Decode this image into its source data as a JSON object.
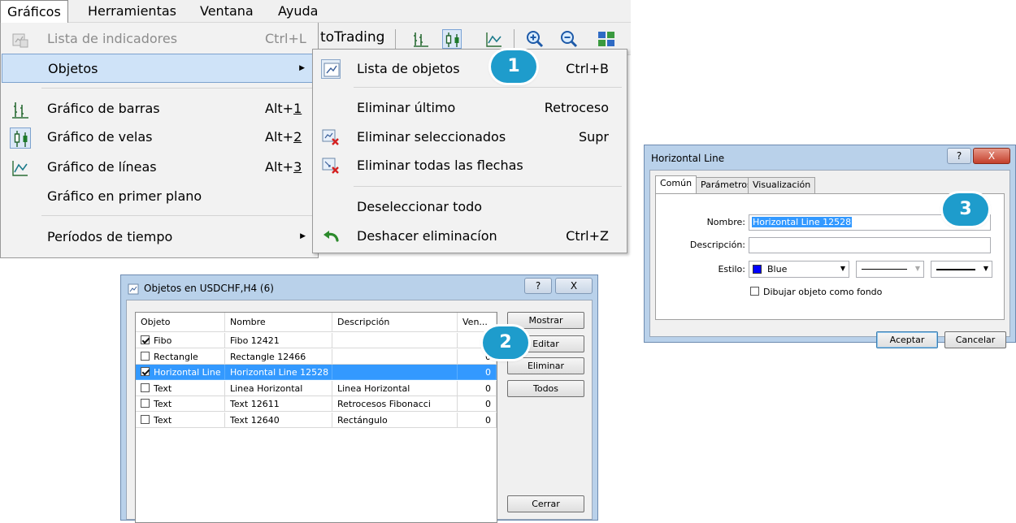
{
  "menubar": {
    "items": [
      "Gráficos",
      "Herramientas",
      "Ventana",
      "Ayuda"
    ]
  },
  "toolbar": {
    "autotrading_fragment": "toTrading"
  },
  "graficos_menu": {
    "items": [
      {
        "label": "Lista de indicadores",
        "shortcut": "Ctrl+L",
        "icon": "indicator-list-icon",
        "disabled": true
      },
      {
        "label": "Objetos",
        "shortcut": "",
        "icon": "",
        "submenu": true,
        "highlighted": true
      },
      {
        "label": "Gráfico de barras",
        "shortcut_prefix": "Alt+",
        "shortcut_key": "1",
        "icon": "bar-chart-icon"
      },
      {
        "label": "Gráfico de velas",
        "shortcut_prefix": "Alt+",
        "shortcut_key": "2",
        "icon": "candlestick-chart-icon",
        "checked": true
      },
      {
        "label": "Gráfico de líneas",
        "shortcut_prefix": "Alt+",
        "shortcut_key": "3",
        "icon": "line-chart-icon"
      },
      {
        "label": "Gráfico en primer plano",
        "shortcut": "",
        "icon": ""
      },
      {
        "label": "Períodos de tiempo",
        "shortcut": "",
        "icon": "",
        "submenu": true
      }
    ]
  },
  "objetos_submenu": {
    "items": [
      {
        "label": "Lista de objetos",
        "shortcut": "Ctrl+B",
        "icon": "objects-list-icon"
      },
      {
        "label": "Eliminar último",
        "shortcut": "Retroceso",
        "icon": ""
      },
      {
        "label": "Eliminar seleccionados",
        "shortcut": "Supr",
        "icon": "delete-selected-icon"
      },
      {
        "label": "Eliminar todas las flechas",
        "shortcut": "",
        "icon": "delete-arrows-icon"
      },
      {
        "label": "Deseleccionar todo",
        "shortcut": "",
        "icon": ""
      },
      {
        "label": "Deshacer eliminacíon",
        "shortcut": "Ctrl+Z",
        "icon": "undo-icon"
      }
    ]
  },
  "badges": {
    "one": "1",
    "two": "2",
    "three": "3"
  },
  "badge_color": "#1e9ccc",
  "objects_dialog": {
    "title": "Objetos en USDCHF,H4 (6)",
    "help": "?",
    "close": "X",
    "columns": [
      "Objeto",
      "Nombre",
      "Descripción",
      "Ven..."
    ],
    "rows": [
      {
        "checked": true,
        "objeto": "Fibo",
        "nombre": "Fibo 12421",
        "descripcion": "",
        "ventana": "0",
        "selected": false
      },
      {
        "checked": false,
        "objeto": "Rectangle",
        "nombre": "Rectangle 12466",
        "descripcion": "",
        "ventana": "0",
        "selected": false
      },
      {
        "checked": true,
        "objeto": "Horizontal Line",
        "nombre": "Horizontal Line 12528",
        "descripcion": "",
        "ventana": "0",
        "selected": true
      },
      {
        "checked": false,
        "objeto": "Text",
        "nombre": "Linea Horizontal",
        "descripcion": "Linea Horizontal",
        "ventana": "0",
        "selected": false
      },
      {
        "checked": false,
        "objeto": "Text",
        "nombre": "Text 12611",
        "descripcion": "Retrocesos Fibonacci",
        "ventana": "0",
        "selected": false
      },
      {
        "checked": false,
        "objeto": "Text",
        "nombre": "Text 12640",
        "descripcion": "Rectángulo",
        "ventana": "0",
        "selected": false
      }
    ],
    "buttons": {
      "mostrar": "Mostrar",
      "editar": "Editar",
      "eliminar": "Eliminar",
      "todos": "Todos",
      "cerrar": "Cerrar"
    },
    "selection_color": "#3399ff"
  },
  "hline_dialog": {
    "title": "Horizontal Line",
    "help": "?",
    "close": "X",
    "tabs": [
      "Común",
      "Parámetros",
      "Visualización"
    ],
    "fields": {
      "nombre_label": "Nombre:",
      "nombre_value": "Horizontal Line 12528",
      "descripcion_label": "Descripción:",
      "descripcion_value": "",
      "estilo_label": "Estilo:",
      "color_name": "Blue",
      "color_hex": "#0000ff",
      "background_checkbox": "Dibujar objeto como fondo"
    },
    "buttons": {
      "aceptar": "Aceptar",
      "cancelar": "Cancelar"
    }
  }
}
